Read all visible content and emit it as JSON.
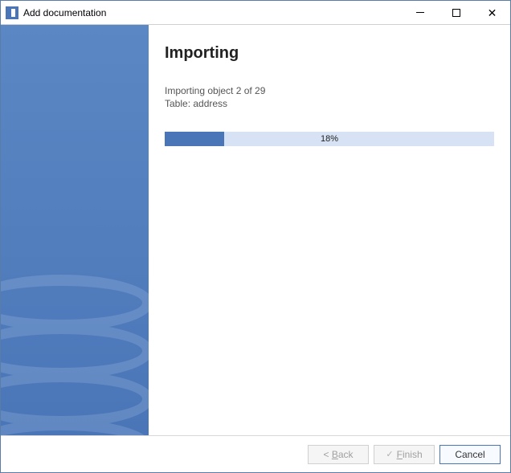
{
  "window": {
    "title": "Add documentation"
  },
  "main": {
    "heading": "Importing",
    "status_line1": "Importing object 2 of 29",
    "status_line2": "Table: address",
    "progress_percent": 18,
    "progress_label": "18%"
  },
  "footer": {
    "back_label": "< Back",
    "finish_label": "Finish",
    "cancel_label": "Cancel"
  }
}
